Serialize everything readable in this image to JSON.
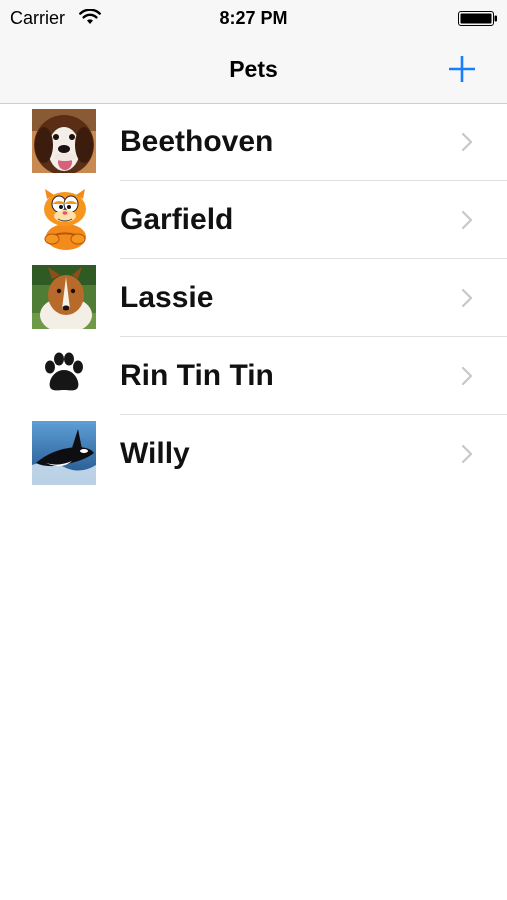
{
  "status_bar": {
    "carrier": "Carrier",
    "time": "8:27 PM",
    "wifi_icon": "wifi-icon",
    "battery_icon": "battery-icon"
  },
  "nav": {
    "title": "Pets",
    "add_icon": "plus-icon",
    "accent_color": "#1a7efb"
  },
  "pets": [
    {
      "name": "Beethoven",
      "image": "saint-bernard-dog-photo"
    },
    {
      "name": "Garfield",
      "image": "orange-cartoon-cat"
    },
    {
      "name": "Lassie",
      "image": "collie-dog-photo"
    },
    {
      "name": "Rin Tin Tin",
      "image": "paw-print-icon"
    },
    {
      "name": "Willy",
      "image": "orca-whale-photo"
    }
  ],
  "disclosure_icon": "chevron-right-icon"
}
